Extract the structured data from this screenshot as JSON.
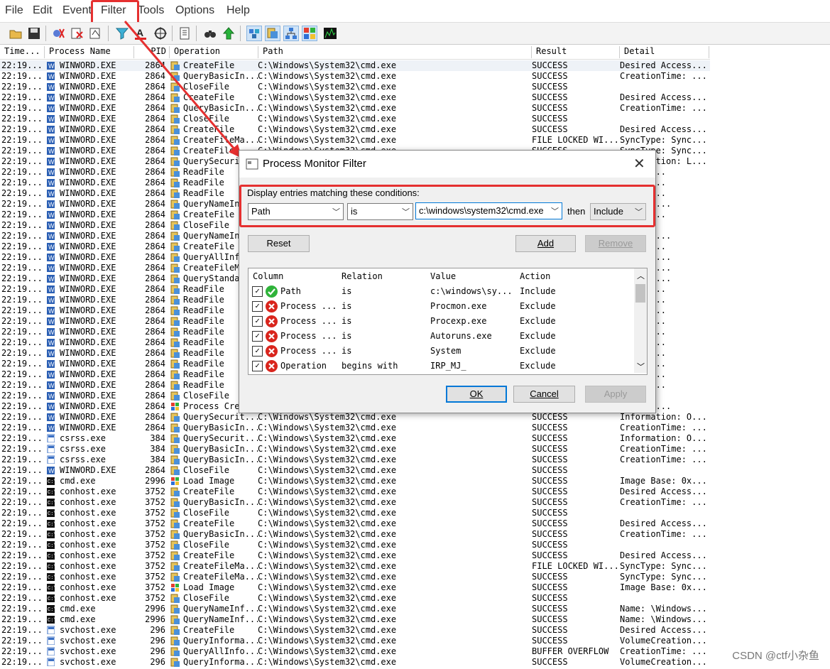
{
  "menu": [
    "File",
    "Edit",
    "Event",
    "Filter",
    "Tools",
    "Options",
    "Help"
  ],
  "columns": [
    "Time...",
    "Process Name",
    "PID",
    "Operation",
    "Path",
    "Result",
    "Detail"
  ],
  "rows": [
    [
      "22:19...",
      "WINWORD.EXE",
      "2864",
      "CreateFile",
      "C:\\Windows\\System32\\cmd.exe",
      "SUCCESS",
      "Desired Access..."
    ],
    [
      "22:19...",
      "WINWORD.EXE",
      "2864",
      "QueryBasicIn...",
      "C:\\Windows\\System32\\cmd.exe",
      "SUCCESS",
      "CreationTime: ..."
    ],
    [
      "22:19...",
      "WINWORD.EXE",
      "2864",
      "CloseFile",
      "C:\\Windows\\System32\\cmd.exe",
      "SUCCESS",
      ""
    ],
    [
      "22:19...",
      "WINWORD.EXE",
      "2864",
      "CreateFile",
      "C:\\Windows\\System32\\cmd.exe",
      "SUCCESS",
      "Desired Access..."
    ],
    [
      "22:19...",
      "WINWORD.EXE",
      "2864",
      "QueryBasicIn...",
      "C:\\Windows\\System32\\cmd.exe",
      "SUCCESS",
      "CreationTime: ..."
    ],
    [
      "22:19...",
      "WINWORD.EXE",
      "2864",
      "CloseFile",
      "C:\\Windows\\System32\\cmd.exe",
      "SUCCESS",
      ""
    ],
    [
      "22:19...",
      "WINWORD.EXE",
      "2864",
      "CreateFile",
      "C:\\Windows\\System32\\cmd.exe",
      "SUCCESS",
      "Desired Access..."
    ],
    [
      "22:19...",
      "WINWORD.EXE",
      "2864",
      "CreateFileMa...",
      "C:\\Windows\\System32\\cmd.exe",
      "FILE LOCKED WI...",
      "SyncType: Sync..."
    ],
    [
      "22:19...",
      "WINWORD.EXE",
      "2864",
      "CreateFile",
      "C:\\Windows\\System32\\cmd.exe",
      "SUCCESS",
      "SyncType: Sync..."
    ],
    [
      "22:19...",
      "WINWORD.EXE",
      "2864",
      "QuerySecuri",
      "",
      "",
      "Information: L..."
    ],
    [
      "22:19...",
      "WINWORD.EXE",
      "2864",
      "ReadFile",
      "",
      "",
      "0, Len..."
    ],
    [
      "22:19...",
      "WINWORD.EXE",
      "2864",
      "ReadFile",
      "",
      "",
      "107,52..."
    ],
    [
      "22:19...",
      "WINWORD.EXE",
      "2864",
      "ReadFile",
      "",
      "",
      "261,12..."
    ],
    [
      "22:19...",
      "WINWORD.EXE",
      "2864",
      "QueryNameIn",
      "",
      "",
      "Windows..."
    ],
    [
      "22:19...",
      "WINWORD.EXE",
      "2864",
      "CreateFile",
      "",
      "",
      "Access..."
    ],
    [
      "22:19...",
      "WINWORD.EXE",
      "2864",
      "CloseFile",
      "",
      "",
      ""
    ],
    [
      "22:19...",
      "WINWORD.EXE",
      "2864",
      "QueryNameIn",
      "",
      "",
      "Windows..."
    ],
    [
      "22:19...",
      "WINWORD.EXE",
      "2864",
      "CreateFile",
      "",
      "",
      "Access..."
    ],
    [
      "22:19...",
      "WINWORD.EXE",
      "2864",
      "QueryAllInf",
      "",
      "",
      "nTime: ..."
    ],
    [
      "22:19...",
      "WINWORD.EXE",
      "2864",
      "CreateFileM",
      "",
      "",
      "e: Sync..."
    ],
    [
      "22:19...",
      "WINWORD.EXE",
      "2864",
      "QueryStanda",
      "",
      "",
      "ionSize..."
    ],
    [
      "22:19...",
      "WINWORD.EXE",
      "2864",
      "ReadFile",
      "",
      "",
      "0, Len..."
    ],
    [
      "22:19...",
      "WINWORD.EXE",
      "2864",
      "ReadFile",
      "",
      "",
      "32,768..."
    ],
    [
      "22:19...",
      "WINWORD.EXE",
      "2864",
      "ReadFile",
      "",
      "",
      "65,536..."
    ],
    [
      "22:19...",
      "WINWORD.EXE",
      "2864",
      "ReadFile",
      "",
      "",
      "98,304..."
    ],
    [
      "22:19...",
      "WINWORD.EXE",
      "2864",
      "ReadFile",
      "",
      "",
      "131,07..."
    ],
    [
      "22:19...",
      "WINWORD.EXE",
      "2864",
      "ReadFile",
      "",
      "",
      "163,84..."
    ],
    [
      "22:19...",
      "WINWORD.EXE",
      "2864",
      "ReadFile",
      "",
      "",
      "196,60..."
    ],
    [
      "22:19...",
      "WINWORD.EXE",
      "2864",
      "ReadFile",
      "",
      "",
      "229,37..."
    ],
    [
      "22:19...",
      "WINWORD.EXE",
      "2864",
      "ReadFile",
      "",
      "",
      "262,14..."
    ],
    [
      "22:19...",
      "WINWORD.EXE",
      "2864",
      "ReadFile",
      "",
      "",
      "294,91..."
    ],
    [
      "22:19...",
      "WINWORD.EXE",
      "2864",
      "CloseFile",
      "",
      "",
      ""
    ],
    [
      "22:19...",
      "WINWORD.EXE",
      "2864",
      "Process Cre",
      "",
      "",
      "96, Com..."
    ],
    [
      "22:19...",
      "WINWORD.EXE",
      "2864",
      "QuerySecurit...",
      "C:\\Windows\\System32\\cmd.exe",
      "SUCCESS",
      "Information: O..."
    ],
    [
      "22:19...",
      "WINWORD.EXE",
      "2864",
      "QueryBasicIn...",
      "C:\\Windows\\System32\\cmd.exe",
      "SUCCESS",
      "CreationTime: ..."
    ],
    [
      "22:19...",
      "csrss.exe",
      "384",
      "QuerySecurit...",
      "C:\\Windows\\System32\\cmd.exe",
      "SUCCESS",
      "Information: O..."
    ],
    [
      "22:19...",
      "csrss.exe",
      "384",
      "QueryBasicIn...",
      "C:\\Windows\\System32\\cmd.exe",
      "SUCCESS",
      "CreationTime: ..."
    ],
    [
      "22:19...",
      "csrss.exe",
      "384",
      "QueryBasicIn...",
      "C:\\Windows\\System32\\cmd.exe",
      "SUCCESS",
      "CreationTime: ..."
    ],
    [
      "22:19...",
      "WINWORD.EXE",
      "2864",
      "CloseFile",
      "C:\\Windows\\System32\\cmd.exe",
      "SUCCESS",
      ""
    ],
    [
      "22:19...",
      "cmd.exe",
      "2996",
      "Load Image",
      "C:\\Windows\\System32\\cmd.exe",
      "SUCCESS",
      "Image Base: 0x..."
    ],
    [
      "22:19...",
      "conhost.exe",
      "3752",
      "CreateFile",
      "C:\\Windows\\System32\\cmd.exe",
      "SUCCESS",
      "Desired Access..."
    ],
    [
      "22:19...",
      "conhost.exe",
      "3752",
      "QueryBasicIn...",
      "C:\\Windows\\System32\\cmd.exe",
      "SUCCESS",
      "CreationTime: ..."
    ],
    [
      "22:19...",
      "conhost.exe",
      "3752",
      "CloseFile",
      "C:\\Windows\\System32\\cmd.exe",
      "SUCCESS",
      ""
    ],
    [
      "22:19...",
      "conhost.exe",
      "3752",
      "CreateFile",
      "C:\\Windows\\System32\\cmd.exe",
      "SUCCESS",
      "Desired Access..."
    ],
    [
      "22:19...",
      "conhost.exe",
      "3752",
      "QueryBasicIn...",
      "C:\\Windows\\System32\\cmd.exe",
      "SUCCESS",
      "CreationTime: ..."
    ],
    [
      "22:19...",
      "conhost.exe",
      "3752",
      "CloseFile",
      "C:\\Windows\\System32\\cmd.exe",
      "SUCCESS",
      ""
    ],
    [
      "22:19...",
      "conhost.exe",
      "3752",
      "CreateFile",
      "C:\\Windows\\System32\\cmd.exe",
      "SUCCESS",
      "Desired Access..."
    ],
    [
      "22:19...",
      "conhost.exe",
      "3752",
      "CreateFileMa...",
      "C:\\Windows\\System32\\cmd.exe",
      "FILE LOCKED WI...",
      "SyncType: Sync..."
    ],
    [
      "22:19...",
      "conhost.exe",
      "3752",
      "CreateFileMa...",
      "C:\\Windows\\System32\\cmd.exe",
      "SUCCESS",
      "SyncType: Sync..."
    ],
    [
      "22:19...",
      "conhost.exe",
      "3752",
      "Load Image",
      "C:\\Windows\\System32\\cmd.exe",
      "SUCCESS",
      "Image Base: 0x..."
    ],
    [
      "22:19...",
      "conhost.exe",
      "3752",
      "CloseFile",
      "C:\\Windows\\System32\\cmd.exe",
      "SUCCESS",
      ""
    ],
    [
      "22:19...",
      "cmd.exe",
      "2996",
      "QueryNameInf...",
      "C:\\Windows\\System32\\cmd.exe",
      "SUCCESS",
      "Name: \\Windows..."
    ],
    [
      "22:19...",
      "cmd.exe",
      "2996",
      "QueryNameInf...",
      "C:\\Windows\\System32\\cmd.exe",
      "SUCCESS",
      "Name: \\Windows..."
    ],
    [
      "22:19...",
      "svchost.exe",
      "296",
      "CreateFile",
      "C:\\Windows\\System32\\cmd.exe",
      "SUCCESS",
      "Desired Access..."
    ],
    [
      "22:19...",
      "svchost.exe",
      "296",
      "QueryInforma...",
      "C:\\Windows\\System32\\cmd.exe",
      "SUCCESS",
      "VolumeCreation..."
    ],
    [
      "22:19...",
      "svchost.exe",
      "296",
      "QueryAllInfo...",
      "C:\\Windows\\System32\\cmd.exe",
      "BUFFER OVERFLOW",
      "CreationTime: ..."
    ],
    [
      "22:19...",
      "svchost.exe",
      "296",
      "QueryInforma...",
      "C:\\Windows\\System32\\cmd.exe",
      "SUCCESS",
      "VolumeCreation..."
    ]
  ],
  "dialog": {
    "title": "Process Monitor Filter",
    "conditions_label": "Display entries matching these conditions:",
    "column_value": "Path",
    "relation_value": "is",
    "value_text": "c:\\windows\\system32\\cmd.exe",
    "then_label": "then",
    "action_value": "Include",
    "reset_label": "Reset",
    "add_label": "Add",
    "remove_label": "Remove",
    "list_headers": [
      "Column",
      "Relation",
      "Value",
      "Action"
    ],
    "filters": [
      {
        "column": "Path",
        "relation": "is",
        "value": "c:\\windows\\sy...",
        "action": "Include",
        "status": "include"
      },
      {
        "column": "Process ...",
        "relation": "is",
        "value": "Procmon.exe",
        "action": "Exclude",
        "status": "exclude"
      },
      {
        "column": "Process ...",
        "relation": "is",
        "value": "Procexp.exe",
        "action": "Exclude",
        "status": "exclude"
      },
      {
        "column": "Process ...",
        "relation": "is",
        "value": "Autoruns.exe",
        "action": "Exclude",
        "status": "exclude"
      },
      {
        "column": "Process ...",
        "relation": "is",
        "value": "System",
        "action": "Exclude",
        "status": "exclude"
      },
      {
        "column": "Operation",
        "relation": "begins with",
        "value": "IRP_MJ_",
        "action": "Exclude",
        "status": "exclude"
      }
    ],
    "ok_label": "OK",
    "cancel_label": "Cancel",
    "apply_label": "Apply"
  },
  "colors": {
    "annotation": "#e53030",
    "accent": "#0078d7"
  },
  "watermark": "CSDN @ctf小杂鱼"
}
